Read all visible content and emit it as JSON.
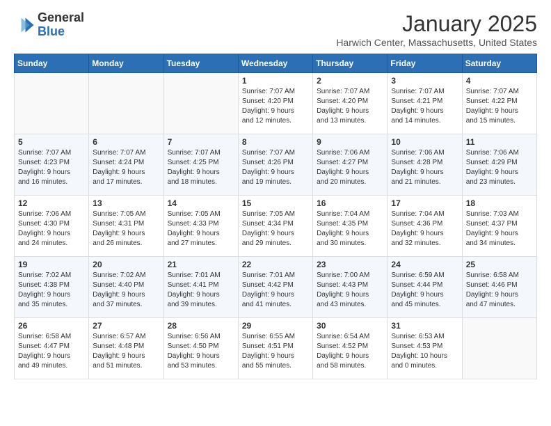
{
  "header": {
    "logo_general": "General",
    "logo_blue": "Blue",
    "month": "January 2025",
    "location": "Harwich Center, Massachusetts, United States"
  },
  "days_of_week": [
    "Sunday",
    "Monday",
    "Tuesday",
    "Wednesday",
    "Thursday",
    "Friday",
    "Saturday"
  ],
  "weeks": [
    [
      {
        "day": "",
        "info": ""
      },
      {
        "day": "",
        "info": ""
      },
      {
        "day": "",
        "info": ""
      },
      {
        "day": "1",
        "info": "Sunrise: 7:07 AM\nSunset: 4:20 PM\nDaylight: 9 hours\nand 12 minutes."
      },
      {
        "day": "2",
        "info": "Sunrise: 7:07 AM\nSunset: 4:20 PM\nDaylight: 9 hours\nand 13 minutes."
      },
      {
        "day": "3",
        "info": "Sunrise: 7:07 AM\nSunset: 4:21 PM\nDaylight: 9 hours\nand 14 minutes."
      },
      {
        "day": "4",
        "info": "Sunrise: 7:07 AM\nSunset: 4:22 PM\nDaylight: 9 hours\nand 15 minutes."
      }
    ],
    [
      {
        "day": "5",
        "info": "Sunrise: 7:07 AM\nSunset: 4:23 PM\nDaylight: 9 hours\nand 16 minutes."
      },
      {
        "day": "6",
        "info": "Sunrise: 7:07 AM\nSunset: 4:24 PM\nDaylight: 9 hours\nand 17 minutes."
      },
      {
        "day": "7",
        "info": "Sunrise: 7:07 AM\nSunset: 4:25 PM\nDaylight: 9 hours\nand 18 minutes."
      },
      {
        "day": "8",
        "info": "Sunrise: 7:07 AM\nSunset: 4:26 PM\nDaylight: 9 hours\nand 19 minutes."
      },
      {
        "day": "9",
        "info": "Sunrise: 7:06 AM\nSunset: 4:27 PM\nDaylight: 9 hours\nand 20 minutes."
      },
      {
        "day": "10",
        "info": "Sunrise: 7:06 AM\nSunset: 4:28 PM\nDaylight: 9 hours\nand 21 minutes."
      },
      {
        "day": "11",
        "info": "Sunrise: 7:06 AM\nSunset: 4:29 PM\nDaylight: 9 hours\nand 23 minutes."
      }
    ],
    [
      {
        "day": "12",
        "info": "Sunrise: 7:06 AM\nSunset: 4:30 PM\nDaylight: 9 hours\nand 24 minutes."
      },
      {
        "day": "13",
        "info": "Sunrise: 7:05 AM\nSunset: 4:31 PM\nDaylight: 9 hours\nand 26 minutes."
      },
      {
        "day": "14",
        "info": "Sunrise: 7:05 AM\nSunset: 4:33 PM\nDaylight: 9 hours\nand 27 minutes."
      },
      {
        "day": "15",
        "info": "Sunrise: 7:05 AM\nSunset: 4:34 PM\nDaylight: 9 hours\nand 29 minutes."
      },
      {
        "day": "16",
        "info": "Sunrise: 7:04 AM\nSunset: 4:35 PM\nDaylight: 9 hours\nand 30 minutes."
      },
      {
        "day": "17",
        "info": "Sunrise: 7:04 AM\nSunset: 4:36 PM\nDaylight: 9 hours\nand 32 minutes."
      },
      {
        "day": "18",
        "info": "Sunrise: 7:03 AM\nSunset: 4:37 PM\nDaylight: 9 hours\nand 34 minutes."
      }
    ],
    [
      {
        "day": "19",
        "info": "Sunrise: 7:02 AM\nSunset: 4:38 PM\nDaylight: 9 hours\nand 35 minutes."
      },
      {
        "day": "20",
        "info": "Sunrise: 7:02 AM\nSunset: 4:40 PM\nDaylight: 9 hours\nand 37 minutes."
      },
      {
        "day": "21",
        "info": "Sunrise: 7:01 AM\nSunset: 4:41 PM\nDaylight: 9 hours\nand 39 minutes."
      },
      {
        "day": "22",
        "info": "Sunrise: 7:01 AM\nSunset: 4:42 PM\nDaylight: 9 hours\nand 41 minutes."
      },
      {
        "day": "23",
        "info": "Sunrise: 7:00 AM\nSunset: 4:43 PM\nDaylight: 9 hours\nand 43 minutes."
      },
      {
        "day": "24",
        "info": "Sunrise: 6:59 AM\nSunset: 4:44 PM\nDaylight: 9 hours\nand 45 minutes."
      },
      {
        "day": "25",
        "info": "Sunrise: 6:58 AM\nSunset: 4:46 PM\nDaylight: 9 hours\nand 47 minutes."
      }
    ],
    [
      {
        "day": "26",
        "info": "Sunrise: 6:58 AM\nSunset: 4:47 PM\nDaylight: 9 hours\nand 49 minutes."
      },
      {
        "day": "27",
        "info": "Sunrise: 6:57 AM\nSunset: 4:48 PM\nDaylight: 9 hours\nand 51 minutes."
      },
      {
        "day": "28",
        "info": "Sunrise: 6:56 AM\nSunset: 4:50 PM\nDaylight: 9 hours\nand 53 minutes."
      },
      {
        "day": "29",
        "info": "Sunrise: 6:55 AM\nSunset: 4:51 PM\nDaylight: 9 hours\nand 55 minutes."
      },
      {
        "day": "30",
        "info": "Sunrise: 6:54 AM\nSunset: 4:52 PM\nDaylight: 9 hours\nand 58 minutes."
      },
      {
        "day": "31",
        "info": "Sunrise: 6:53 AM\nSunset: 4:53 PM\nDaylight: 10 hours\nand 0 minutes."
      },
      {
        "day": "",
        "info": ""
      }
    ]
  ]
}
